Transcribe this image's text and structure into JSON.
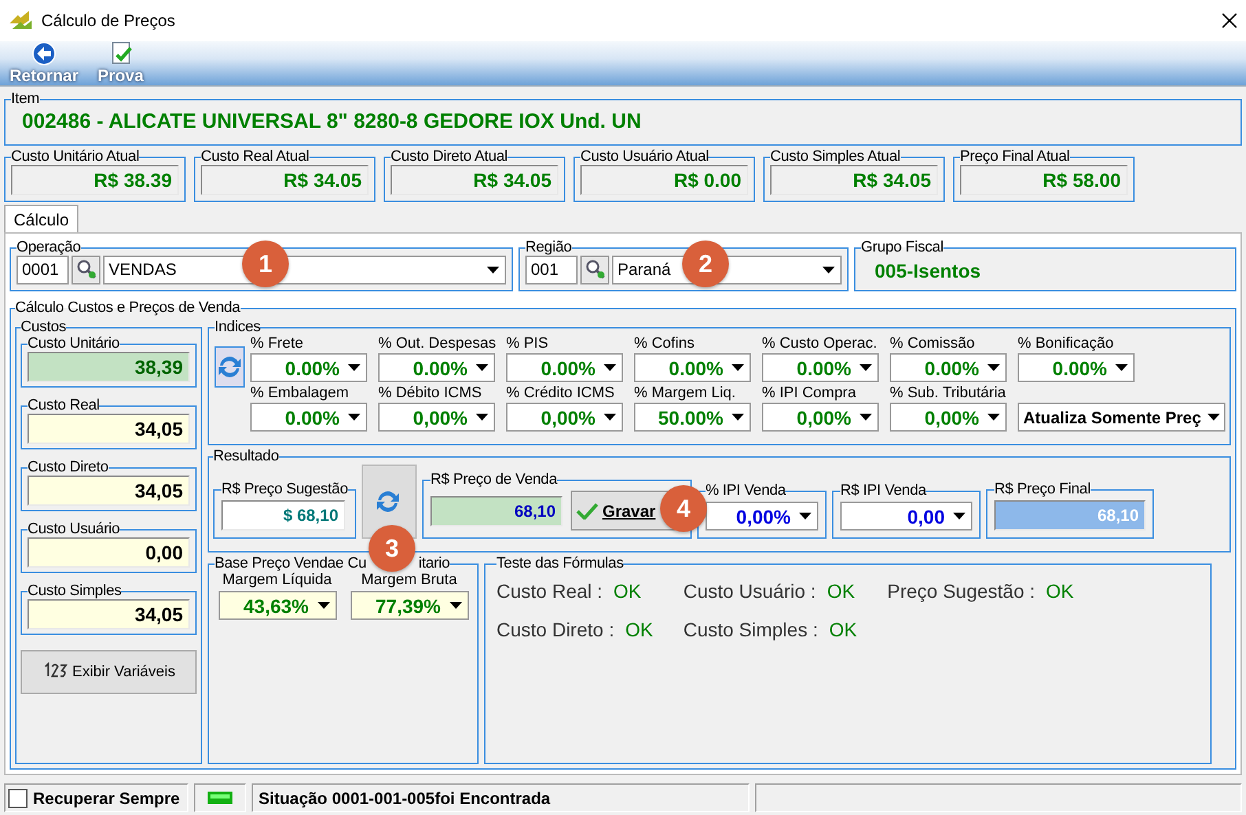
{
  "window": {
    "title": "Cálculo de Preços"
  },
  "toolbar": [
    {
      "label": "Retornar",
      "kind": "back"
    },
    {
      "label": "Prova",
      "kind": "check"
    }
  ],
  "item": {
    "legend": "Item",
    "value": "002486 - ALICATE UNIVERSAL 8\" 8280-8 GEDORE IOX Und. UN"
  },
  "current_costs": [
    {
      "label": "Custo Unitário Atual",
      "value": "R$ 38.39"
    },
    {
      "label": "Custo Real Atual",
      "value": "R$ 34.05"
    },
    {
      "label": "Custo Direto Atual",
      "value": "R$ 34.05"
    },
    {
      "label": "Custo Usuário Atual",
      "value": "R$ 0.00"
    },
    {
      "label": "Custo Simples Atual",
      "value": "R$ 34.05"
    },
    {
      "label": "Preço Final Atual",
      "value": "R$ 58.00"
    }
  ],
  "tabs": [
    {
      "label": "Cálculo",
      "selected": true
    }
  ],
  "operation": {
    "legend": "Operação",
    "code": "0001",
    "value": "VENDAS"
  },
  "region": {
    "legend": "Região",
    "code": "001",
    "value": "Paraná"
  },
  "fiscal_group": {
    "legend": "Grupo Fiscal",
    "value": "005-Isentos"
  },
  "calculation": {
    "legend": "Cálculo Custos e Preços de Venda"
  },
  "costs": {
    "legend": "Custos",
    "button": "Exibir Variáveis",
    "items": [
      {
        "label": "Custo Unitário",
        "value": "38,39",
        "kind": "green"
      },
      {
        "label": "Custo Real",
        "value": "34,05",
        "kind": "yellow"
      },
      {
        "label": "Custo Direto",
        "value": "34,05",
        "kind": "yellow"
      },
      {
        "label": "Custo Usuário",
        "value": "0,00",
        "kind": "yellow"
      },
      {
        "label": "Custo Simples",
        "value": "34,05",
        "kind": "yellow"
      }
    ]
  },
  "indices": {
    "legend": "Indices",
    "mode": "Atualiza Somente Preç",
    "fields": [
      {
        "label": "% Frete",
        "value": "0.00%"
      },
      {
        "label": "% Out. Despesas",
        "value": "0.00%"
      },
      {
        "label": "% PIS",
        "value": "0.00%"
      },
      {
        "label": "% Cofins",
        "value": "0.00%"
      },
      {
        "label": "% Custo Operac.",
        "value": "0.00%"
      },
      {
        "label": "% Comissão",
        "value": "0.00%"
      },
      {
        "label": "% Bonificação",
        "value": "0.00%"
      },
      {
        "label": "% Embalagem",
        "value": "0.00%"
      },
      {
        "label": "% Débito ICMS",
        "value": "0,00%"
      },
      {
        "label": "% Crédito ICMS",
        "value": "0,00%"
      },
      {
        "label": "% Margem Liq.",
        "value": "50.00%"
      },
      {
        "label": "% IPI Compra",
        "value": "0,00%"
      },
      {
        "label": "% Sub. Tributária",
        "value": "0,00%"
      }
    ]
  },
  "result": {
    "legend": "Resultado",
    "save": "Gravar",
    "fields": [
      {
        "label": "R$ Preço Sugestão",
        "value": "$ 68,10",
        "kind": "text"
      },
      {
        "label": "R$ Preço de Venda",
        "value": "68,10",
        "kind": "green"
      },
      {
        "label": "% IPI Venda",
        "value": "0,00%",
        "kind": "combo"
      },
      {
        "label": "R$ IPI Venda",
        "value": "0,00",
        "kind": "combo"
      },
      {
        "label": "R$ Preço Final",
        "value": "68,10",
        "kind": "blue"
      }
    ]
  },
  "base_price": {
    "legend_start": "Base Preço Vendae Cu",
    "legend_end": "itario",
    "fields": [
      {
        "label": "Margem Líquida",
        "value": "43,63%"
      },
      {
        "label": "Margem Bruta",
        "value": "77,39%"
      }
    ]
  },
  "formula_test": {
    "legend": "Teste das Fórmulas",
    "results": [
      {
        "label": "Custo Real :",
        "value": "OK"
      },
      {
        "label": "Custo Usuário :",
        "value": "OK"
      },
      {
        "label": "Preço Sugestão :",
        "value": "OK"
      },
      {
        "label": "Custo Direto :",
        "value": "OK"
      },
      {
        "label": "Custo Simples :",
        "value": "OK"
      }
    ]
  },
  "callouts": [
    "1",
    "2",
    "3",
    "4"
  ],
  "status_bar": {
    "checkbox": {
      "label": "Recuperar Sempre",
      "checked": false
    },
    "message": "Situação 0001-001-005foi Encontrada"
  }
}
